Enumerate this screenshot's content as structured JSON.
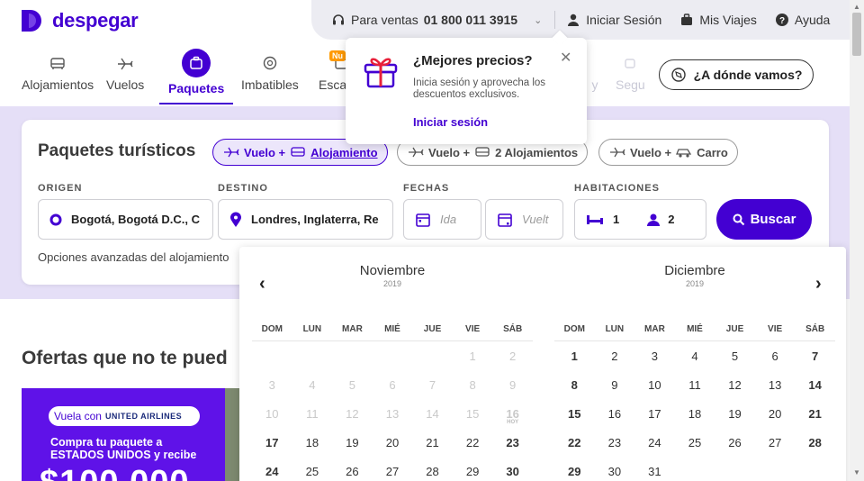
{
  "brand": {
    "name": "despegar",
    "color": "#4300d2"
  },
  "topbar": {
    "phone_label": "Para ventas",
    "phone_number": "01 800 011 3915",
    "login": "Iniciar Sesión",
    "trips": "Mis Viajes",
    "help": "Ayuda"
  },
  "nav": {
    "items": [
      {
        "label": "Alojamientos",
        "icon": "bed-icon"
      },
      {
        "label": "Vuelos",
        "icon": "plane-icon"
      },
      {
        "label": "Paquetes",
        "icon": "suitcase-icon",
        "active": true
      },
      {
        "label": "Imbatibles",
        "icon": "badge-icon"
      },
      {
        "label": "Escap",
        "icon": "getaway-icon",
        "badge": "Nu"
      },
      {
        "label": "y",
        "icon": "activities-icon"
      },
      {
        "label": "Segu",
        "icon": "insurance-icon"
      }
    ],
    "where_button": "¿A dónde vamos?"
  },
  "search": {
    "title": "Paquetes turísticos",
    "product_chips": [
      {
        "label_a": "Vuelo +",
        "label_b": "Alojamiento",
        "active": true
      },
      {
        "label_a": "Vuelo +",
        "label_b": "2 Alojamientos",
        "active": false
      },
      {
        "label_a": "Vuelo +",
        "label_b": "Carro",
        "active": false
      }
    ],
    "origin_label": "ORIGEN",
    "origin_value": "Bogotá, Bogotá D.C., C",
    "destination_label": "DESTINO",
    "destination_value": "Londres, Inglaterra, Re",
    "dates_label": "FECHAS",
    "date_from_placeholder": "Ida",
    "date_to_placeholder": "Vuelt",
    "rooms_label": "HABITACIONES",
    "rooms_count": "1",
    "guests_count": "2",
    "search_button": "Buscar",
    "advanced": "Opciones avanzadas del alojamiento"
  },
  "popover": {
    "title": "¿Mejores precios?",
    "description": "Inicia sesión y aprovecha los descuentos exclusivos.",
    "link": "Iniciar sesión"
  },
  "calendar": {
    "dow": [
      "DOM",
      "LUN",
      "MAR",
      "MIÉ",
      "JUE",
      "VIE",
      "SÁB"
    ],
    "today_tag": "HOY",
    "months": [
      {
        "name": "Noviembre",
        "year": "2019",
        "rows": [
          [
            "",
            "",
            "",
            "",
            "",
            "1",
            "2"
          ],
          [
            "3",
            "4",
            "5",
            "6",
            "7",
            "8",
            "9"
          ],
          [
            "10",
            "11",
            "12",
            "13",
            "14",
            "15",
            "16"
          ],
          [
            "17",
            "18",
            "19",
            "20",
            "21",
            "22",
            "23"
          ],
          [
            "24",
            "25",
            "26",
            "27",
            "28",
            "29",
            "30"
          ]
        ],
        "disabled_until": 16,
        "today": 16
      },
      {
        "name": "Diciembre",
        "year": "2019",
        "rows": [
          [
            "1",
            "2",
            "3",
            "4",
            "5",
            "6",
            "7"
          ],
          [
            "8",
            "9",
            "10",
            "11",
            "12",
            "13",
            "14"
          ],
          [
            "15",
            "16",
            "17",
            "18",
            "19",
            "20",
            "21"
          ],
          [
            "22",
            "23",
            "24",
            "25",
            "26",
            "27",
            "28"
          ],
          [
            "29",
            "30",
            "31",
            "",
            "",
            "",
            ""
          ]
        ],
        "disabled_until": 0,
        "today": 0
      }
    ]
  },
  "offers": {
    "title": "Ofertas que no te pued",
    "promo_pill": "Vuela con",
    "promo_airline": "UNITED AIRLINES",
    "promo_line1": "Compra tu paquete a",
    "promo_line2": "ESTADOS UNIDOS y recibe",
    "promo_amount": "$100.000"
  }
}
